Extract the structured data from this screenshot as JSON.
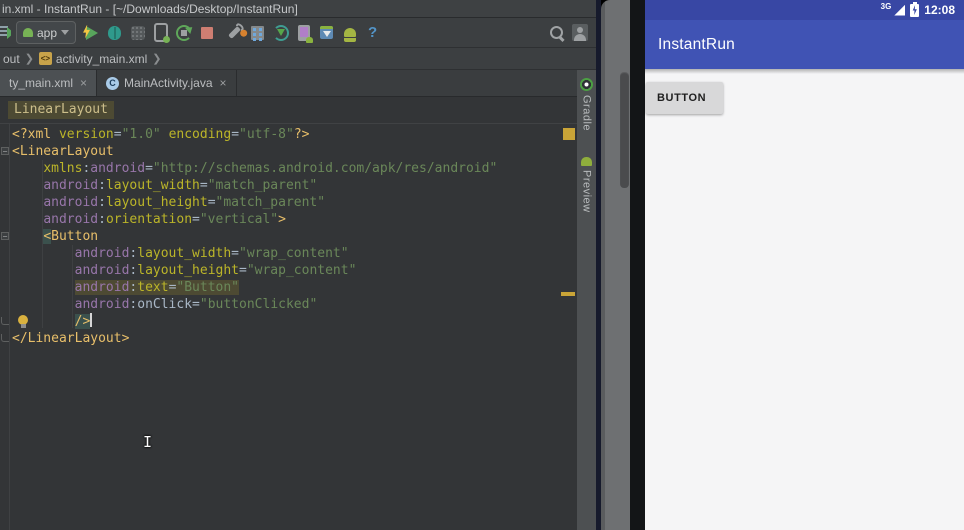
{
  "window_title": "in.xml - InstantRun - [~/Downloads/Desktop/InstantRun]",
  "toolbar": {
    "run_config": "app",
    "help_label": "?",
    "icons": [
      "run-config-android",
      "run",
      "debug",
      "run-with-coverage",
      "attach-profiler",
      "rerun",
      "stop",
      "sdk-manager-wrench",
      "project-structure",
      "gradle-sync",
      "avd-manager",
      "sdk-manager",
      "android-device-monitor",
      "help",
      "search",
      "avatar"
    ]
  },
  "breadcrumbs": {
    "items": [
      "out",
      "activity_main.xml"
    ]
  },
  "tabs": [
    {
      "label": "ty_main.xml",
      "close": "×",
      "selected": true
    },
    {
      "label": "MainActivity.java",
      "close": "×",
      "icon": "C",
      "selected": false
    }
  ],
  "editor": {
    "context_tag": "LinearLayout",
    "code_lines": [
      {
        "tokens": [
          [
            "tag",
            "<?xml "
          ],
          [
            "attr",
            "version"
          ],
          [
            "plain",
            "="
          ],
          [
            "val",
            "\"1.0\""
          ],
          [
            "plain",
            " "
          ],
          [
            "attr",
            "encoding"
          ],
          [
            "plain",
            "="
          ],
          [
            "val",
            "\"utf-8\""
          ],
          [
            "tag",
            "?>"
          ]
        ]
      },
      {
        "fold": "open",
        "tokens": [
          [
            "tag",
            "<LinearLayout"
          ]
        ]
      },
      {
        "tokens": [
          [
            "plain",
            "    "
          ],
          [
            "attr",
            "xmlns"
          ],
          [
            "plain",
            ":"
          ],
          [
            "ns",
            "android"
          ],
          [
            "plain",
            "="
          ],
          [
            "val",
            "\"http://schemas.android.com/apk/res/android\""
          ]
        ]
      },
      {
        "tokens": [
          [
            "plain",
            "    "
          ],
          [
            "ns",
            "android"
          ],
          [
            "plain",
            ":"
          ],
          [
            "attr",
            "layout_width"
          ],
          [
            "plain",
            "="
          ],
          [
            "val",
            "\"match_parent\""
          ]
        ]
      },
      {
        "tokens": [
          [
            "plain",
            "    "
          ],
          [
            "ns",
            "android"
          ],
          [
            "plain",
            ":"
          ],
          [
            "attr",
            "layout_height"
          ],
          [
            "plain",
            "="
          ],
          [
            "val",
            "\"match_parent\""
          ]
        ]
      },
      {
        "tokens": [
          [
            "plain",
            "    "
          ],
          [
            "ns",
            "android"
          ],
          [
            "plain",
            ":"
          ],
          [
            "attr",
            "orientation"
          ],
          [
            "plain",
            "="
          ],
          [
            "val",
            "\"vertical\""
          ],
          [
            "tag",
            ">"
          ]
        ]
      },
      {
        "fold": "open",
        "tokens": [
          [
            "plain",
            "    "
          ],
          [
            "tagmark",
            "<"
          ],
          [
            "tag",
            "Button"
          ]
        ]
      },
      {
        "tokens": [
          [
            "plain",
            "        "
          ],
          [
            "ns",
            "android"
          ],
          [
            "plain",
            ":"
          ],
          [
            "attr",
            "layout_width"
          ],
          [
            "plain",
            "="
          ],
          [
            "val",
            "\"wrap_content\""
          ]
        ]
      },
      {
        "tokens": [
          [
            "plain",
            "        "
          ],
          [
            "ns",
            "android"
          ],
          [
            "plain",
            ":"
          ],
          [
            "attr",
            "layout_height"
          ],
          [
            "plain",
            "="
          ],
          [
            "val",
            "\"wrap_content\""
          ]
        ]
      },
      {
        "hl": true,
        "tokens": [
          [
            "plain",
            "        "
          ],
          [
            "ns",
            "android"
          ],
          [
            "plain",
            ":"
          ],
          [
            "attr",
            "text"
          ],
          [
            "plain",
            "="
          ],
          [
            "val",
            "\"Button\""
          ]
        ]
      },
      {
        "tokens": [
          [
            "plain",
            "        "
          ],
          [
            "ns",
            "android"
          ],
          [
            "plain",
            ":"
          ],
          [
            "plain",
            "onClick"
          ],
          [
            "plain",
            "="
          ],
          [
            "val",
            "\"buttonClicked\""
          ]
        ]
      },
      {
        "fold": "end",
        "bulb": true,
        "caret": true,
        "tokens": [
          [
            "plain",
            "        "
          ],
          [
            "tagmark",
            "/>"
          ]
        ]
      },
      {
        "fold": "end",
        "tokens": [
          [
            "tag",
            "</LinearLayout>"
          ]
        ]
      }
    ]
  },
  "tool_window_bar": {
    "items": [
      {
        "label": "Gradle",
        "icon": "gradle-icon"
      },
      {
        "label": "Preview",
        "icon": "android-icon"
      }
    ]
  },
  "emulator": {
    "status_bar": {
      "network_label": "3G",
      "time": "12:08"
    },
    "app_bar": {
      "title": "InstantRun"
    },
    "button_label": "BUTTON",
    "colors": {
      "status_bar": "#3847A4",
      "app_bar": "#4053B4",
      "content_bg": "#F5F5F6",
      "button_bg": "#D8D8D9"
    }
  },
  "colors": {
    "editor_bg": "#333537",
    "toolbar_bg": "#3C3F41",
    "tag": "#E8BF6A",
    "attr": "#BBB529",
    "namespace": "#9876AA",
    "value": "#6A8759",
    "plain": "#A9B7C6",
    "highlight_bg": "#4D4A33",
    "match_bg": "#3B514D",
    "stripe_mark": "#C9A437"
  }
}
